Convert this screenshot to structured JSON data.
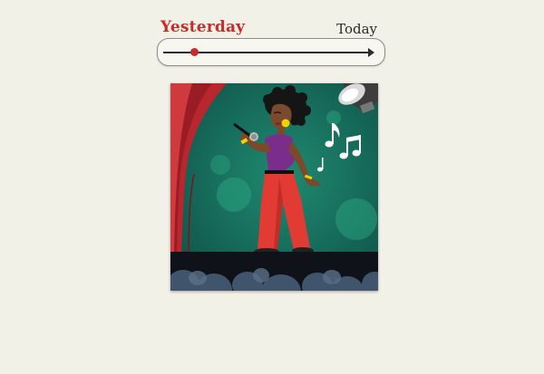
{
  "timeline": {
    "start_label": "Yesterday",
    "end_label": "Today",
    "position": 0.15,
    "accent_color": "#c62d2a"
  },
  "illustration": {
    "subject": "singer-on-stage",
    "icons": [
      "microphone-icon",
      "music-notes-icon",
      "spotlight-icon",
      "stage-curtain-icon"
    ]
  }
}
